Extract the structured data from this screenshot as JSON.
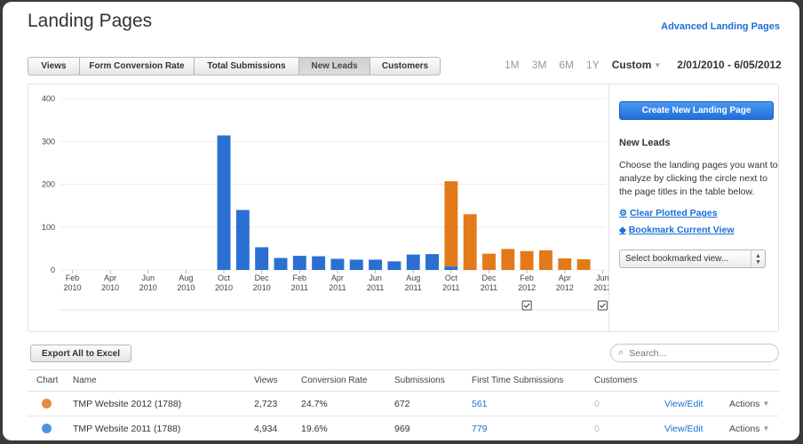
{
  "page": {
    "title": "Landing Pages",
    "advanced_link": "Advanced Landing Pages"
  },
  "tabs": [
    {
      "label": "Views",
      "active": false
    },
    {
      "label": "Form Conversion Rate",
      "active": false
    },
    {
      "label": "Total Submissions",
      "active": false
    },
    {
      "label": "New Leads",
      "active": true
    },
    {
      "label": "Customers",
      "active": false
    }
  ],
  "time_ranges": [
    "1M",
    "3M",
    "6M",
    "1Y"
  ],
  "custom_label": "Custom",
  "date_range": "2/01/2010 - 6/05/2012",
  "sidebar": {
    "create_button": "Create New Landing Page",
    "heading": "New Leads",
    "description": "Choose the landing pages you want to analyze by clicking the circle next to the page titles in the table below.",
    "clear_link": "Clear Plotted Pages",
    "bookmark_link": "Bookmark Current View",
    "bookmark_select": "Select bookmarked view..."
  },
  "chart_data": {
    "type": "bar",
    "stacked": true,
    "ylim": [
      0,
      400
    ],
    "y_ticks": [
      0,
      100,
      200,
      300,
      400
    ],
    "x_tick_labels": [
      [
        "Feb",
        "2010"
      ],
      [
        "Apr",
        "2010"
      ],
      [
        "Jun",
        "2010"
      ],
      [
        "Aug",
        "2010"
      ],
      [
        "Oct",
        "2010"
      ],
      [
        "Dec",
        "2010"
      ],
      [
        "Feb",
        "2011"
      ],
      [
        "Apr",
        "2011"
      ],
      [
        "Jun",
        "2011"
      ],
      [
        "Aug",
        "2011"
      ],
      [
        "Oct",
        "2011"
      ],
      [
        "Dec",
        "2011"
      ],
      [
        "Feb",
        "2012"
      ],
      [
        "Apr",
        "2012"
      ],
      [
        "Jun",
        "2012"
      ]
    ],
    "months": [
      "2010-02",
      "2010-03",
      "2010-04",
      "2010-05",
      "2010-06",
      "2010-07",
      "2010-08",
      "2010-09",
      "2010-10",
      "2010-11",
      "2010-12",
      "2011-01",
      "2011-02",
      "2011-03",
      "2011-04",
      "2011-05",
      "2011-06",
      "2011-07",
      "2011-08",
      "2011-09",
      "2011-10",
      "2011-11",
      "2011-12",
      "2012-01",
      "2012-02",
      "2012-03",
      "2012-04",
      "2012-05",
      "2012-06"
    ],
    "series": [
      {
        "color": "#2a6fd1",
        "values": [
          0,
          0,
          0,
          0,
          0,
          0,
          0,
          0,
          314,
          140,
          53,
          28,
          33,
          32,
          26,
          24,
          24,
          20,
          36,
          37,
          8,
          0,
          0,
          0,
          0,
          0,
          0,
          0,
          0
        ]
      },
      {
        "color": "#e27a1a",
        "values": [
          0,
          0,
          0,
          0,
          0,
          0,
          0,
          0,
          0,
          0,
          0,
          0,
          0,
          0,
          0,
          0,
          0,
          0,
          0,
          0,
          199,
          130,
          38,
          49,
          44,
          46,
          27,
          25,
          0
        ]
      }
    ],
    "grid": true,
    "annotation_markers": [
      "2012-02",
      "2012-06"
    ]
  },
  "toolbar": {
    "export_label": "Export All to Excel",
    "search_placeholder": "Search..."
  },
  "table": {
    "columns": [
      "Chart",
      "Name",
      "Views",
      "Conversion Rate",
      "Submissions",
      "First Time Submissions",
      "Customers"
    ],
    "rows": [
      {
        "dot_color": "#e88a3a",
        "name": "TMP Website 2012 (1788)",
        "views": "2,723",
        "conversion_rate": "24.7%",
        "submissions": "672",
        "first_time": "561",
        "customers": "0",
        "view_edit": "View/Edit",
        "actions": "Actions"
      },
      {
        "dot_color": "#4d94e6",
        "name": "TMP Website 2011 (1788)",
        "views": "4,934",
        "conversion_rate": "19.6%",
        "submissions": "969",
        "first_time": "779",
        "customers": "0",
        "view_edit": "View/Edit",
        "actions": "Actions"
      }
    ]
  }
}
